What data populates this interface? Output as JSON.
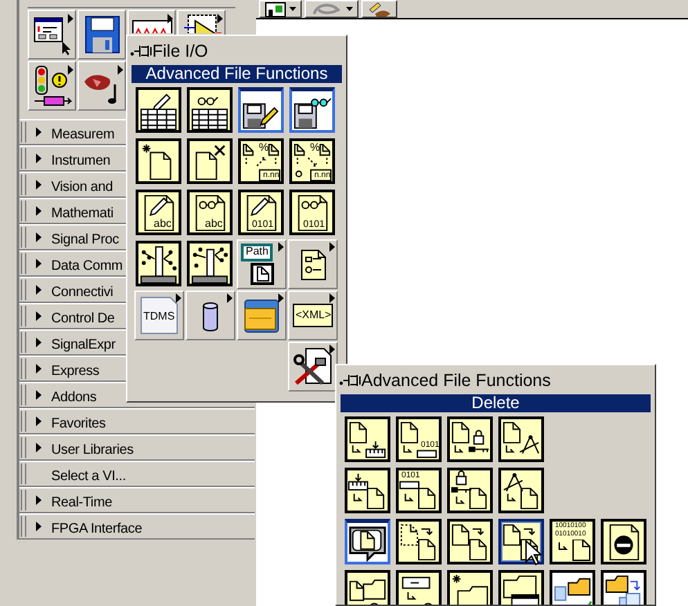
{
  "toolbar": {
    "buttons": [
      {
        "kind": "chart",
        "dropdown": true
      },
      {
        "kind": "swirl",
        "dropdown": true
      },
      {
        "kind": "pencil-brush",
        "dropdown": false
      }
    ]
  },
  "functions_palette": {
    "icons": [
      {
        "kind": "dialog",
        "submenu": true
      },
      {
        "kind": "floppy",
        "submenu": false
      },
      {
        "kind": "waveform",
        "submenu": true
      },
      {
        "kind": "amplifier",
        "submenu": true
      },
      {
        "kind": "traffic-light",
        "submenu": true
      },
      {
        "kind": "sound",
        "submenu": true
      }
    ],
    "categories": [
      {
        "label": "Measurem",
        "submenu": true
      },
      {
        "label": "Instrumen",
        "submenu": true
      },
      {
        "label": "Vision and",
        "submenu": true
      },
      {
        "label": "Mathemati",
        "submenu": true
      },
      {
        "label": "Signal Proc",
        "submenu": true
      },
      {
        "label": "Data Comm",
        "submenu": true
      },
      {
        "label": "Connectivi",
        "submenu": true
      },
      {
        "label": "Control De",
        "submenu": true
      },
      {
        "label": "SignalExpr",
        "submenu": true
      },
      {
        "label": "Express",
        "submenu": true
      },
      {
        "label": "Addons",
        "submenu": true
      },
      {
        "label": "Favorites",
        "submenu": true
      },
      {
        "label": "User Libraries",
        "submenu": true
      },
      {
        "label": "Select a VI...",
        "submenu": false
      },
      {
        "label": "Real-Time",
        "submenu": true
      },
      {
        "label": "FPGA Interface",
        "submenu": true
      }
    ]
  },
  "file_io_palette": {
    "title": "File I/O",
    "header": "Advanced File Functions",
    "rows": [
      [
        {
          "kind": "spreadsheet-write",
          "submenu": false
        },
        {
          "kind": "spreadsheet-read",
          "submenu": false
        },
        {
          "kind": "file-write",
          "submenu": false
        },
        {
          "kind": "file-read",
          "submenu": false
        }
      ],
      [
        {
          "kind": "new-file",
          "submenu": false
        },
        {
          "kind": "delete-file",
          "submenu": false
        },
        {
          "kind": "format-into",
          "submenu": false,
          "texts": [
            "%",
            "n.nn"
          ]
        },
        {
          "kind": "scan-from",
          "submenu": false,
          "texts": [
            "%",
            "n.nn"
          ]
        }
      ],
      [
        {
          "kind": "text-write",
          "submenu": false,
          "texts": [
            "abc"
          ]
        },
        {
          "kind": "text-read",
          "submenu": false,
          "texts": [
            "abc"
          ]
        },
        {
          "kind": "binary-write",
          "submenu": false,
          "texts": [
            "0101"
          ]
        },
        {
          "kind": "binary-read",
          "submenu": false,
          "texts": [
            "0101"
          ]
        }
      ],
      [
        {
          "kind": "datalog-write",
          "submenu": false
        },
        {
          "kind": "datalog-read",
          "submenu": false
        },
        {
          "kind": "path",
          "submenu": true,
          "texts": [
            "Path"
          ]
        },
        {
          "kind": "config",
          "submenu": true
        }
      ],
      [
        {
          "kind": "tdms",
          "submenu": true,
          "texts": [
            "TDMS"
          ]
        },
        {
          "kind": "storage",
          "submenu": true
        },
        {
          "kind": "folder",
          "submenu": true
        },
        {
          "kind": "xml",
          "submenu": true,
          "texts": [
            "<XML>"
          ]
        }
      ],
      [
        {
          "kind": "tools",
          "submenu": true
        }
      ]
    ]
  },
  "advanced_palette": {
    "title": "Advanced File Functions",
    "header": "Delete",
    "rows": [
      [
        {
          "kind": "doc-ruler",
          "hovered": false
        },
        {
          "kind": "doc-binary",
          "hovered": false,
          "texts": [
            "0101"
          ]
        },
        {
          "kind": "doc-lock",
          "hovered": false
        },
        {
          "kind": "doc-compass",
          "hovered": false
        }
      ],
      [
        {
          "kind": "ruler-doc",
          "hovered": false
        },
        {
          "kind": "binary-doc",
          "hovered": false,
          "texts": [
            "0101"
          ]
        },
        {
          "kind": "lock-doc",
          "hovered": false
        },
        {
          "kind": "compass-doc",
          "hovered": false
        }
      ],
      [
        {
          "kind": "delete",
          "hovered": false
        },
        {
          "kind": "copy",
          "hovered": false
        },
        {
          "kind": "move",
          "hovered": false
        },
        {
          "kind": "move",
          "hovered": true
        },
        {
          "kind": "binary-pattern",
          "hovered": false,
          "texts": [
            "10010100",
            "01010010"
          ]
        },
        {
          "kind": "stop",
          "hovered": false
        }
      ],
      [
        {
          "kind": "folder-info",
          "hovered": false
        },
        {
          "kind": "field-info",
          "hovered": false
        },
        {
          "kind": "new-folder",
          "hovered": false
        },
        {
          "kind": "folder-window",
          "hovered": false
        },
        {
          "kind": "docs-folder",
          "hovered": false
        },
        {
          "kind": "folder-copy",
          "hovered": false
        }
      ]
    ]
  }
}
